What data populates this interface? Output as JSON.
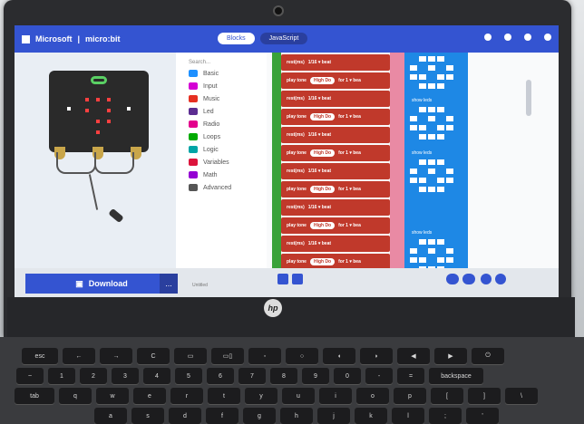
{
  "app": {
    "brand": "Microsoft",
    "product": "micro:bit"
  },
  "tabs": [
    {
      "label": "Blocks"
    },
    {
      "label": "JavaScript"
    }
  ],
  "toolbox": {
    "search_placeholder": "Search...",
    "categories": [
      {
        "label": "Basic",
        "color": "#1e90ff"
      },
      {
        "label": "Input",
        "color": "#d400d4"
      },
      {
        "label": "Music",
        "color": "#e63022"
      },
      {
        "label": "Led",
        "color": "#5c2d91"
      },
      {
        "label": "Radio",
        "color": "#e3008c"
      },
      {
        "label": "Loops",
        "color": "#00aa00"
      },
      {
        "label": "Logic",
        "color": "#00a4a6"
      },
      {
        "label": "Variables",
        "color": "#dc143c"
      },
      {
        "label": "Math",
        "color": "#9400d3"
      },
      {
        "label": "Advanced",
        "color": "#555555"
      }
    ]
  },
  "workspace": {
    "blocks": [
      {
        "type": "rest",
        "text": "rest(ms)",
        "value": "1/16 ▾ beat"
      },
      {
        "type": "play",
        "text": "play tone",
        "pill": "High Do",
        "tail": "for 1 ▾ bea"
      },
      {
        "type": "rest",
        "text": "rest(ms)",
        "value": "1/16 ▾ beat"
      },
      {
        "type": "play",
        "text": "play tone",
        "pill": "High Do",
        "tail": "for 1 ▾ bea"
      },
      {
        "type": "rest",
        "text": "rest(ms)",
        "value": "1/16 ▾ beat"
      },
      {
        "type": "play",
        "text": "play tone",
        "pill": "High Do",
        "tail": "for 1 ▾ bea"
      },
      {
        "type": "rest",
        "text": "rest(ms)",
        "value": "1/16 ▾ beat"
      },
      {
        "type": "play",
        "text": "play tone",
        "pill": "High Do",
        "tail": "for 1 ▾ bea"
      },
      {
        "type": "rest",
        "text": "rest(ms)",
        "value": "1/16 ▾ beat"
      },
      {
        "type": "play",
        "text": "play tone",
        "pill": "High Do",
        "tail": "for 1 ▾ bea"
      },
      {
        "type": "rest",
        "text": "rest(ms)",
        "value": "1/16 ▾ beat"
      },
      {
        "type": "play",
        "text": "play tone",
        "pill": "High Do",
        "tail": "for 1 ▾ bea"
      },
      {
        "type": "rest",
        "text": "rest(ms)",
        "value": "1/16 ▾ beat"
      }
    ],
    "show_leds_label": "show leds"
  },
  "bottom": {
    "download_label": "Download",
    "more_label": "...",
    "project_name": "Untitled"
  },
  "laptop": {
    "logo": "hp"
  },
  "keyboard": {
    "row1": [
      "esc",
      "←",
      "→",
      "C",
      "▭",
      "▭▯",
      "◦",
      "○",
      "◖",
      "◗",
      "◀",
      "▶",
      "⏻"
    ],
    "row2": [
      "~",
      "1",
      "2",
      "3",
      "4",
      "5",
      "6",
      "7",
      "8",
      "9",
      "0",
      "-",
      "=",
      "backspace"
    ],
    "row3": [
      "tab",
      "q",
      "w",
      "e",
      "r",
      "t",
      "y",
      "u",
      "i",
      "o",
      "p",
      "[",
      "]",
      "\\"
    ],
    "row4": [
      "a",
      "s",
      "d",
      "f",
      "g",
      "h",
      "j",
      "k",
      "l",
      ";",
      "'"
    ]
  }
}
